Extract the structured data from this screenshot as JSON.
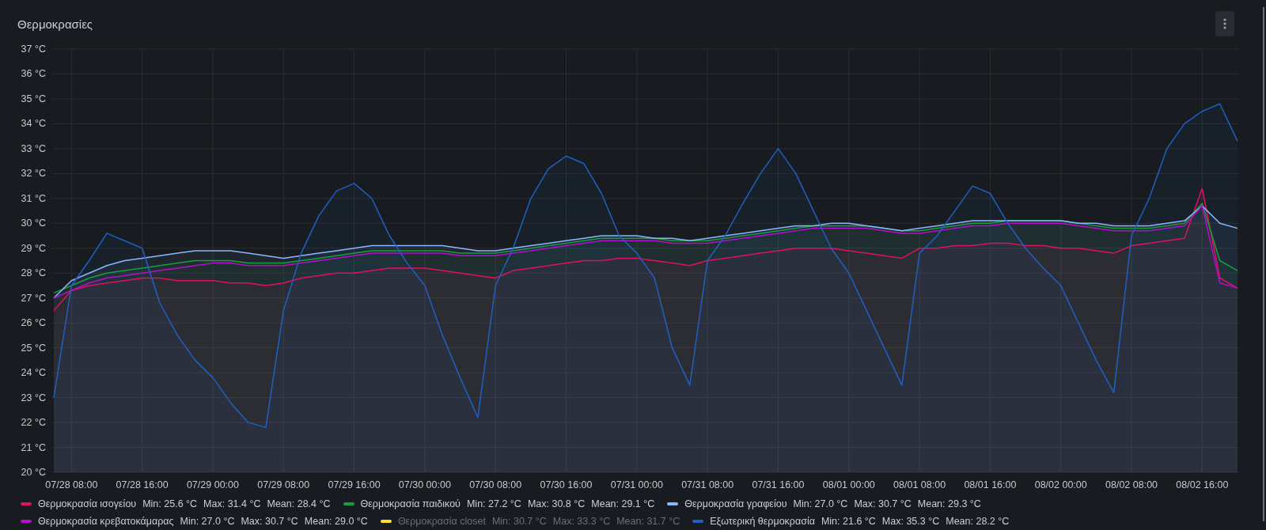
{
  "panel": {
    "title": "Θερμοκρασίες",
    "chart_data": {
      "type": "area",
      "grid": true,
      "ylim": [
        20,
        37
      ],
      "categories": [
        null,
        "07/28 08:00",
        null,
        null,
        null,
        "07/28 16:00",
        null,
        null,
        null,
        "07/29 00:00",
        null,
        null,
        null,
        "07/29 08:00",
        null,
        null,
        null,
        "07/29 16:00",
        null,
        null,
        null,
        "07/30 00:00",
        null,
        null,
        null,
        "07/30 08:00",
        null,
        null,
        null,
        "07/30 16:00",
        null,
        null,
        null,
        "07/31 00:00",
        null,
        null,
        null,
        "07/31 08:00",
        null,
        null,
        null,
        "07/31 16:00",
        null,
        null,
        null,
        "08/01 00:00",
        null,
        null,
        null,
        "08/01 08:00",
        null,
        null,
        null,
        "08/01 16:00",
        null,
        null,
        null,
        "08/02 00:00",
        null,
        null,
        null,
        "08/02 08:00",
        null,
        null,
        null,
        "08/02 16:00",
        null,
        null
      ],
      "yticks": [
        {
          "value": 37,
          "label": "37 °C"
        },
        {
          "value": 36,
          "label": "36 °C"
        },
        {
          "value": 35,
          "label": "35 °C"
        },
        {
          "value": 34,
          "label": "34 °C"
        },
        {
          "value": 33,
          "label": "33 °C"
        },
        {
          "value": 32,
          "label": "32 °C"
        },
        {
          "value": 31,
          "label": "31 °C"
        },
        {
          "value": 30,
          "label": "30 °C"
        },
        {
          "value": 29,
          "label": "29 °C"
        },
        {
          "value": 28,
          "label": "28 °C"
        },
        {
          "value": 27,
          "label": "27 °C"
        },
        {
          "value": 26,
          "label": "26 °C"
        },
        {
          "value": 25,
          "label": "25 °C"
        },
        {
          "value": 24,
          "label": "24 °C"
        },
        {
          "value": 23,
          "label": "23 °C"
        },
        {
          "value": 22,
          "label": "22 °C"
        },
        {
          "value": 21,
          "label": "21 °C"
        },
        {
          "value": 20,
          "label": "20 °C"
        }
      ],
      "series": [
        {
          "name": "Θερμοκρασία ισογείου",
          "color": "#e0115f",
          "values": [
            26.5,
            27.3,
            27.5,
            27.6,
            27.7,
            27.8,
            27.8,
            27.7,
            27.7,
            27.7,
            27.6,
            27.6,
            27.5,
            27.6,
            27.8,
            27.9,
            28.0,
            28.0,
            28.1,
            28.2,
            28.2,
            28.2,
            28.1,
            28.0,
            27.9,
            27.8,
            28.1,
            28.2,
            28.3,
            28.4,
            28.5,
            28.5,
            28.6,
            28.6,
            28.5,
            28.4,
            28.3,
            28.5,
            28.6,
            28.7,
            28.8,
            28.9,
            29.0,
            29.0,
            29.0,
            28.9,
            28.8,
            28.7,
            28.6,
            29.0,
            29.0,
            29.1,
            29.1,
            29.2,
            29.2,
            29.1,
            29.1,
            29.0,
            29.0,
            28.9,
            28.8,
            29.1,
            29.2,
            29.3,
            29.4,
            31.4,
            27.8,
            27.4
          ]
        },
        {
          "name": "Θερμοκρασία παιδικού",
          "color": "#1a9d3f",
          "values": [
            27.2,
            27.5,
            27.8,
            28.0,
            28.1,
            28.2,
            28.3,
            28.4,
            28.5,
            28.5,
            28.5,
            28.4,
            28.4,
            28.4,
            28.5,
            28.6,
            28.7,
            28.8,
            28.9,
            28.9,
            28.9,
            28.9,
            28.9,
            28.8,
            28.8,
            28.8,
            28.9,
            29.0,
            29.1,
            29.2,
            29.3,
            29.4,
            29.4,
            29.4,
            29.4,
            29.3,
            29.3,
            29.3,
            29.4,
            29.5,
            29.6,
            29.7,
            29.8,
            29.9,
            29.9,
            29.9,
            29.9,
            29.8,
            29.7,
            29.7,
            29.8,
            29.9,
            30.0,
            30.0,
            30.1,
            30.1,
            30.1,
            30.1,
            30.0,
            29.9,
            29.8,
            29.8,
            29.8,
            29.9,
            30.0,
            30.8,
            28.5,
            28.1
          ]
        },
        {
          "name": "Θερμοκρασία γραφείου",
          "color": "#8ab8ff",
          "values": [
            27.0,
            27.7,
            28.0,
            28.3,
            28.5,
            28.6,
            28.7,
            28.8,
            28.9,
            28.9,
            28.9,
            28.8,
            28.7,
            28.6,
            28.7,
            28.8,
            28.9,
            29.0,
            29.1,
            29.1,
            29.1,
            29.1,
            29.1,
            29.0,
            28.9,
            28.9,
            29.0,
            29.1,
            29.2,
            29.3,
            29.4,
            29.5,
            29.5,
            29.5,
            29.4,
            29.4,
            29.3,
            29.4,
            29.5,
            29.6,
            29.7,
            29.8,
            29.9,
            29.9,
            30.0,
            30.0,
            29.9,
            29.8,
            29.7,
            29.8,
            29.9,
            30.0,
            30.1,
            30.1,
            30.1,
            30.1,
            30.1,
            30.1,
            30.0,
            30.0,
            29.9,
            29.9,
            29.9,
            30.0,
            30.1,
            30.7,
            30.0,
            29.8
          ]
        },
        {
          "name": "Θερμοκρασία κρεβατοκάμαρας",
          "color": "#b20fce",
          "type": "line",
          "values": [
            27.0,
            27.3,
            27.6,
            27.8,
            27.9,
            28.0,
            28.1,
            28.2,
            28.3,
            28.4,
            28.4,
            28.3,
            28.3,
            28.3,
            28.4,
            28.5,
            28.6,
            28.7,
            28.8,
            28.8,
            28.8,
            28.8,
            28.8,
            28.7,
            28.7,
            28.7,
            28.8,
            28.9,
            29.0,
            29.1,
            29.2,
            29.3,
            29.3,
            29.3,
            29.3,
            29.2,
            29.2,
            29.2,
            29.3,
            29.4,
            29.5,
            29.6,
            29.7,
            29.8,
            29.8,
            29.8,
            29.8,
            29.7,
            29.6,
            29.6,
            29.7,
            29.8,
            29.9,
            29.9,
            30.0,
            30.0,
            30.0,
            30.0,
            29.9,
            29.8,
            29.7,
            29.7,
            29.7,
            29.8,
            29.9,
            30.7,
            27.6,
            27.4
          ]
        },
        {
          "name": "Θερμοκρασία closet",
          "color": "#fade2a",
          "values": [
            null,
            null,
            null,
            null,
            null,
            null,
            null,
            null,
            null,
            null,
            null,
            null,
            null,
            null,
            null,
            null,
            null,
            null,
            null,
            null,
            null,
            null,
            null,
            null,
            null,
            null,
            null,
            null,
            null,
            null,
            null,
            null,
            null,
            null,
            null,
            null,
            null,
            null,
            null,
            null,
            null,
            null,
            null,
            null,
            null,
            null,
            null,
            null,
            null,
            null,
            null,
            null,
            null,
            null,
            null,
            null,
            null,
            null,
            null,
            null,
            null,
            null,
            null,
            null,
            null,
            null,
            null,
            null
          ]
        },
        {
          "name": "Εξωτερική θερμοκρασία",
          "color": "#1f60c4",
          "values": [
            23.0,
            27.5,
            28.5,
            29.6,
            29.3,
            29.0,
            26.8,
            25.5,
            24.5,
            23.8,
            22.8,
            22.0,
            21.8,
            26.5,
            28.8,
            30.3,
            31.3,
            31.6,
            31.0,
            29.5,
            28.4,
            27.5,
            25.5,
            23.8,
            22.2,
            27.5,
            29.0,
            31.0,
            32.2,
            32.7,
            32.4,
            31.2,
            29.5,
            28.8,
            27.8,
            25.0,
            23.5,
            28.5,
            29.5,
            30.8,
            32.0,
            33.0,
            32.0,
            30.5,
            29.0,
            28.0,
            26.5,
            25.0,
            23.5,
            28.8,
            29.5,
            30.5,
            31.5,
            31.2,
            30.0,
            29.0,
            28.2,
            27.5,
            26.0,
            24.5,
            23.2,
            29.5,
            31.0,
            33.0,
            34.0,
            34.5,
            34.8,
            33.3
          ]
        }
      ]
    },
    "legend": [
      {
        "hidden": false,
        "min": "Min: 25.6 °C",
        "max": "Max: 31.4 °C",
        "mean": "Mean: 28.4 °C"
      },
      {
        "hidden": false,
        "min": "Min: 27.2 °C",
        "max": "Max: 30.8 °C",
        "mean": "Mean: 29.1 °C"
      },
      {
        "hidden": false,
        "min": "Min: 27.0 °C",
        "max": "Max: 30.7 °C",
        "mean": "Mean: 29.3 °C"
      },
      {
        "hidden": false,
        "min": "Min: 27.0 °C",
        "max": "Max: 30.7 °C",
        "mean": "Mean: 29.0 °C"
      },
      {
        "hidden": true,
        "min": "Min: 30.7 °C",
        "max": "Max: 33.3 °C",
        "mean": "Mean: 31.7 °C"
      },
      {
        "hidden": false,
        "min": "Min: 21.6 °C",
        "max": "Max: 35.3 °C",
        "mean": "Mean: 28.2 °C"
      }
    ]
  }
}
